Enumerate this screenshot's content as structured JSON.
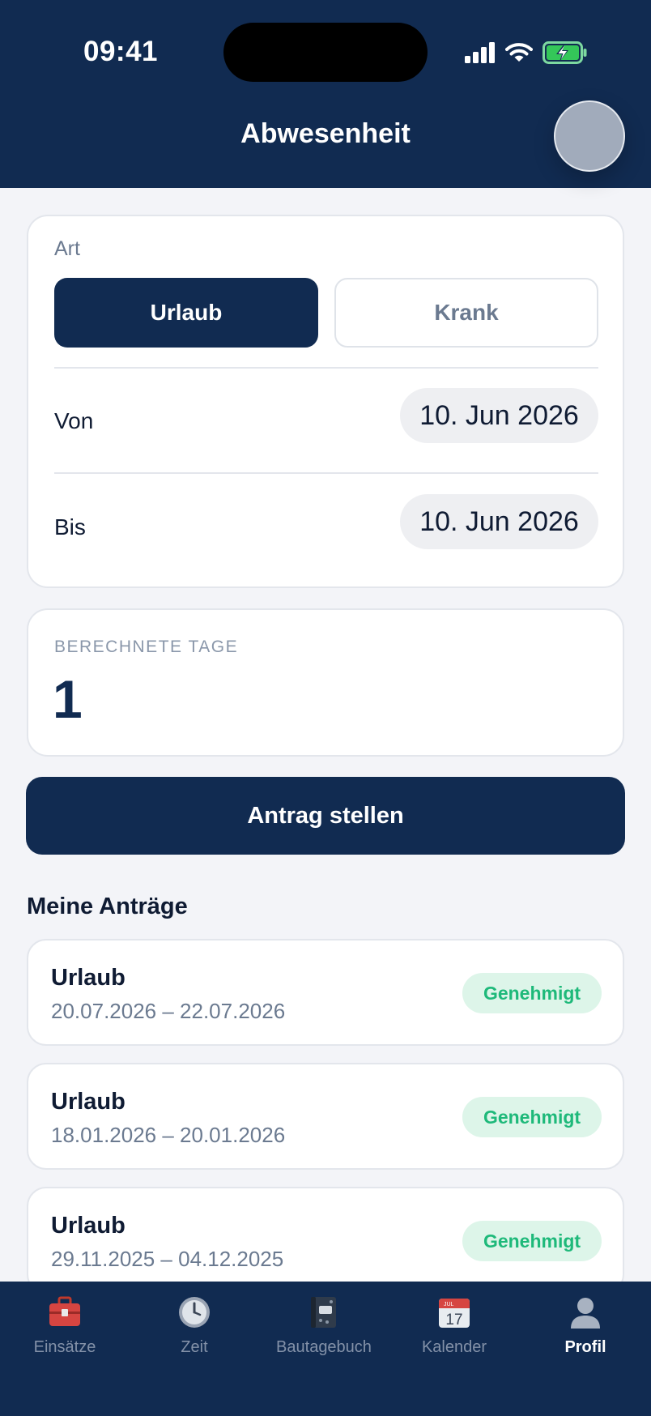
{
  "status_bar": {
    "time": "09:41"
  },
  "header": {
    "title": "Abwesenheit"
  },
  "form": {
    "type_label": "Art",
    "type_options": [
      "Urlaub",
      "Krank"
    ],
    "selected_type": "Urlaub",
    "from_label": "Von",
    "from_value": "10. Jun 2026",
    "to_label": "Bis",
    "to_value": "10. Jun 2026"
  },
  "days": {
    "label": "BERECHNETE TAGE",
    "value": "1"
  },
  "submit_label": "Antrag stellen",
  "requests": {
    "title": "Meine Anträge",
    "items": [
      {
        "type": "Urlaub",
        "dates": "20.07.2026 – 22.07.2026",
        "status": "Genehmigt"
      },
      {
        "type": "Urlaub",
        "dates": "18.01.2026 – 20.01.2026",
        "status": "Genehmigt"
      },
      {
        "type": "Urlaub",
        "dates": "29.11.2025 – 04.12.2025",
        "status": "Genehmigt"
      }
    ]
  },
  "tabbar": {
    "items": [
      {
        "label": "Einsätze",
        "icon": "toolbox-icon"
      },
      {
        "label": "Zeit",
        "icon": "clock-icon"
      },
      {
        "label": "Bautagebuch",
        "icon": "notebook-icon"
      },
      {
        "label": "Kalender",
        "icon": "calendar-icon",
        "icon_text": "17",
        "icon_month": "JUL"
      },
      {
        "label": "Profil",
        "icon": "person-icon"
      }
    ],
    "active": "Profil"
  },
  "colors": {
    "primary": "#112b51",
    "success": "#1eb97a",
    "success_bg": "#ddf5e9",
    "muted": "#6b7a90"
  }
}
